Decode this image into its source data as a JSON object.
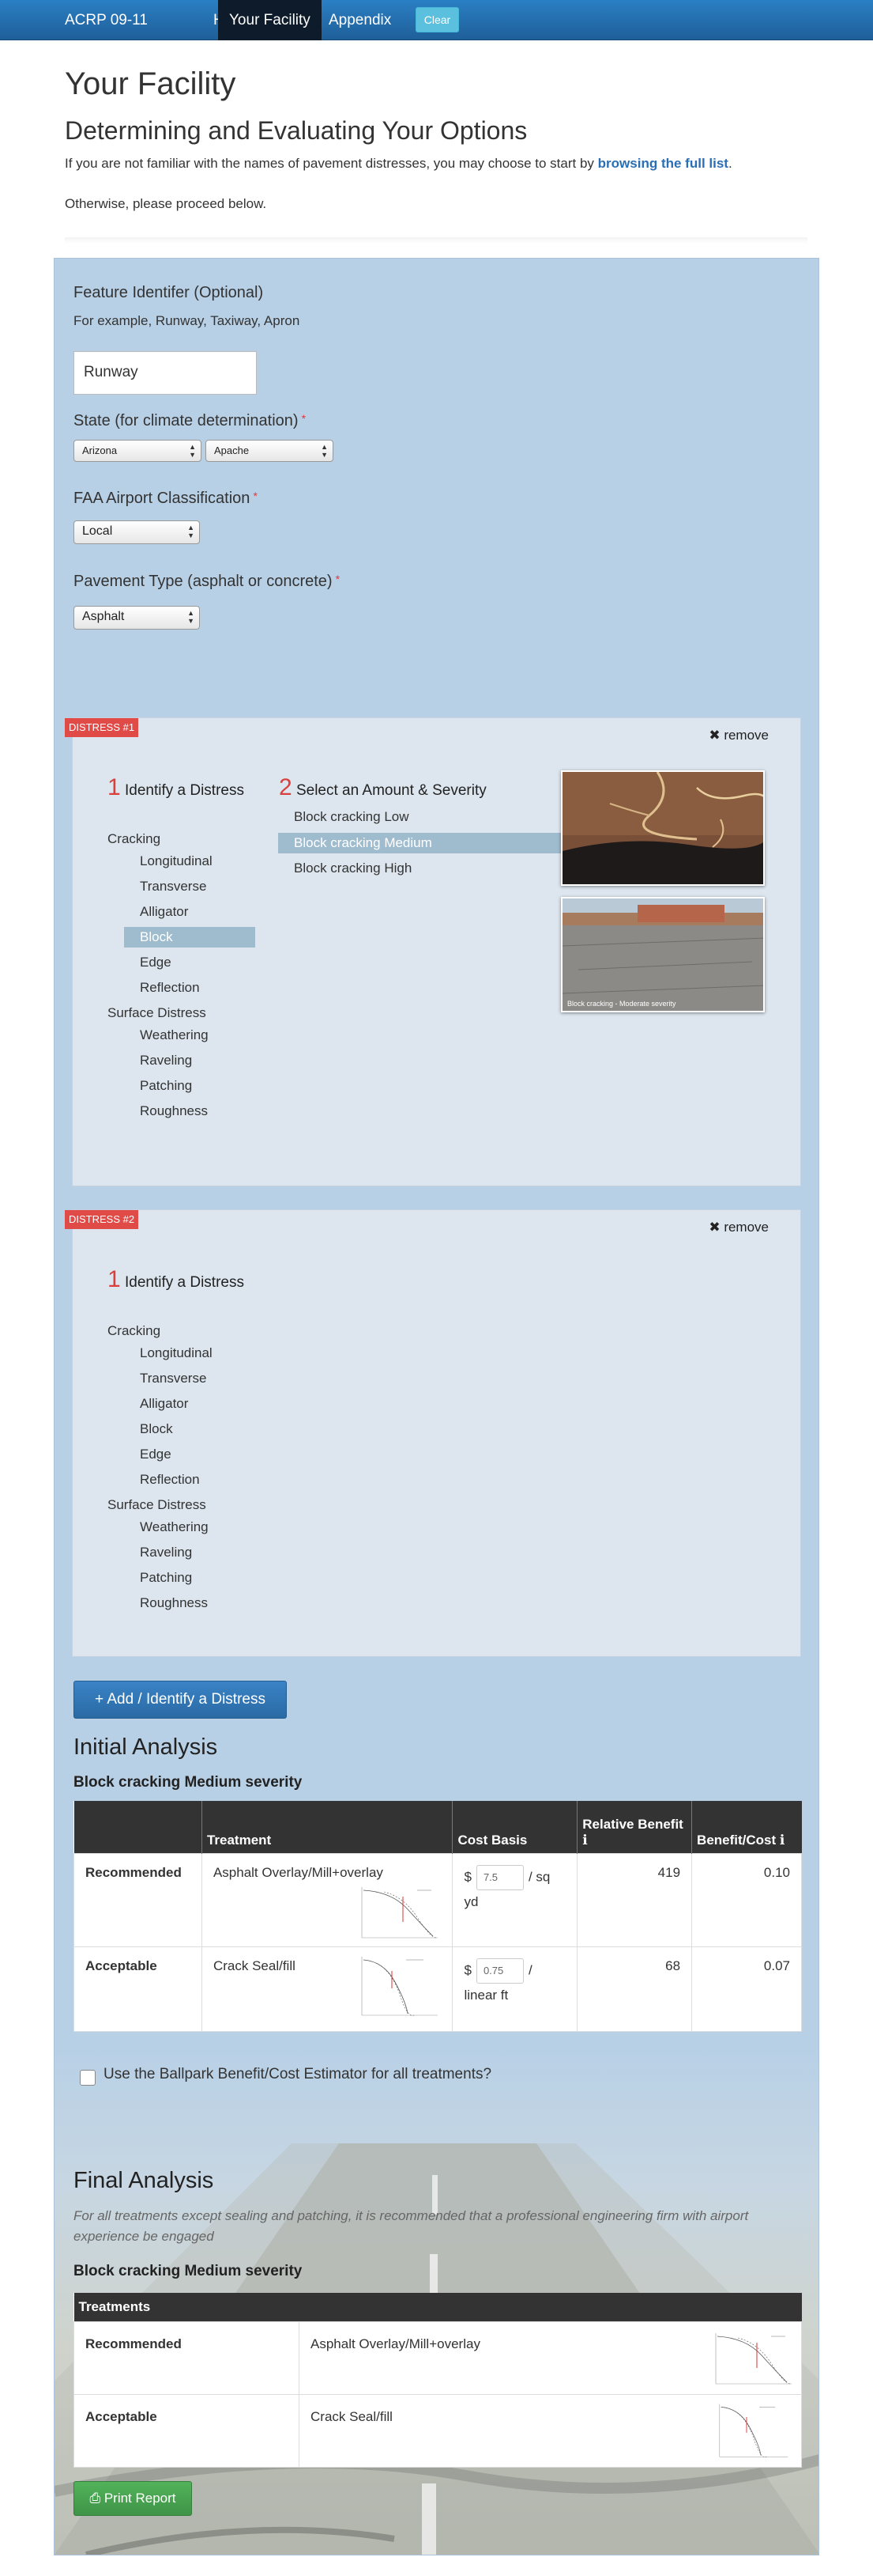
{
  "nav": {
    "brand": "ACRP 09-11",
    "items": [
      {
        "label": "Home"
      },
      {
        "label": "Your Facility"
      },
      {
        "label": "Appendix"
      }
    ],
    "clear_label": "Clear"
  },
  "header": {
    "title": "Your Facility",
    "subtitle": "Determining and Evaluating Your Options",
    "intro_text": "If you are not familiar with the names of pavement distresses, you may choose to start by",
    "intro_link": "browsing the full list",
    "intro_end": ".",
    "otherwise": "Otherwise, please proceed below."
  },
  "form": {
    "feature_label": "Feature Identifer (Optional)",
    "feature_help": "For example, Runway, Taxiway, Apron",
    "feature_value": "Runway",
    "state_label": "State (for climate determination)",
    "state_value": "Arizona",
    "county_value": "Apache",
    "faa_label": "FAA Airport Classification",
    "faa_value": "Local",
    "pavement_label": "Pavement Type (asphalt or concrete)",
    "pavement_value": "Asphalt",
    "required_mark": "*"
  },
  "distress_1": {
    "tag": "DISTRESS #1",
    "remove": "remove",
    "step1_num": "1",
    "step1_title": "Identify a Distress",
    "step2_num": "2",
    "step2_title": "Select an Amount & Severity",
    "categories": {
      "cracking": "Cracking",
      "surface": "Surface Distress"
    },
    "cracking_items": [
      "Longitudinal",
      "Transverse",
      "Alligator",
      "Block",
      "Edge",
      "Reflection"
    ],
    "surface_items": [
      "Weathering",
      "Raveling",
      "Patching",
      "Roughness"
    ],
    "selected_item": "Block",
    "severities": [
      "Block cracking Low",
      "Block cracking Medium",
      "Block cracking High"
    ],
    "selected_severity": "Block cracking Medium",
    "photo_caption": "Block cracking - Moderate severity"
  },
  "distress_2": {
    "tag": "DISTRESS #2",
    "remove": "remove",
    "step1_num": "1",
    "step1_title": "Identify a Distress",
    "categories": {
      "cracking": "Cracking",
      "surface": "Surface Distress"
    },
    "cracking_items": [
      "Longitudinal",
      "Transverse",
      "Alligator",
      "Block",
      "Edge",
      "Reflection"
    ],
    "surface_items": [
      "Weathering",
      "Raveling",
      "Patching",
      "Roughness"
    ]
  },
  "add_distress_label": "+ Add / Identify a Distress",
  "initial_analysis": {
    "title": "Initial Analysis",
    "subtitle": "Block cracking Medium severity",
    "columns": [
      "",
      "Treatment",
      "Cost Basis",
      "Relative Benefit",
      "Benefit/Cost"
    ],
    "rows": [
      {
        "level": "Recommended",
        "treatment": "Asphalt Overlay/Mill+overlay",
        "cost_prefix": "$",
        "cost_value": "7.5",
        "cost_unit": "/ sq yd",
        "benefit": "419",
        "ratio": "0.10"
      },
      {
        "level": "Acceptable",
        "treatment": "Crack Seal/fill",
        "cost_prefix": "$",
        "cost_value": "0.75",
        "cost_unit": "/ linear ft",
        "benefit": "68",
        "ratio": "0.07"
      }
    ]
  },
  "ballpark_label": "Use the Ballpark Benefit/Cost Estimator for all treatments?",
  "final_analysis": {
    "title": "Final Analysis",
    "note": "For all treatments except sealing and patching, it is recommended that a professional engineering firm with airport experience be engaged",
    "subtitle": "Block cracking Medium severity",
    "table_header": "Treatments",
    "rows": [
      {
        "level": "Recommended",
        "treatment": "Asphalt Overlay/Mill+overlay"
      },
      {
        "level": "Acceptable",
        "treatment": "Crack Seal/fill"
      }
    ]
  },
  "print_label": "Print Report",
  "colors": {
    "navbar": "#2a7fc4",
    "panel": "#b8d0e6",
    "card": "#dde6ef",
    "tag": "#e04a47",
    "selected": "#9fbccf",
    "primary_button": "#2a6aa5",
    "success_button": "#3f9447"
  }
}
